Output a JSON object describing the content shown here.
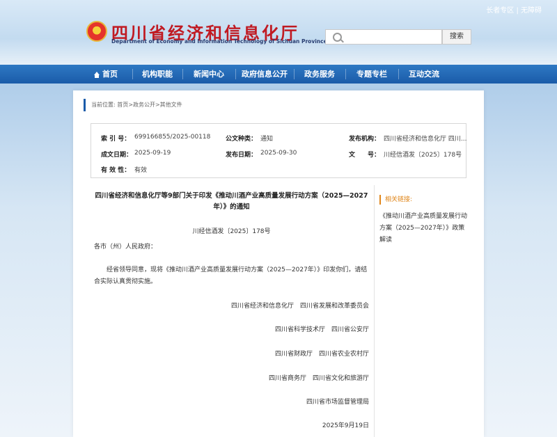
{
  "header": {
    "top_links": {
      "special": "长者专区",
      "separator": "|",
      "accessible": "无障碍"
    },
    "site_title": "四川省经济和信息化厅",
    "site_subtitle": "Department of Economy and Information Technology of Sichuan Province",
    "search": {
      "placeholder": "",
      "button_label": "搜索"
    }
  },
  "nav": {
    "items": [
      {
        "label": "首页"
      },
      {
        "label": "机构职能"
      },
      {
        "label": "新闻中心"
      },
      {
        "label": "政府信息公开"
      },
      {
        "label": "政务服务"
      },
      {
        "label": "专题专栏"
      },
      {
        "label": "互动交流"
      }
    ]
  },
  "breadcrumb": "当前位置: 首页>政务公开>其他文件",
  "meta": {
    "index_no_label": "索 引 号：",
    "index_no": "699166855/2025-00118",
    "category_label": "公文种类：",
    "category": "通知",
    "issuer_label": "发布机构：",
    "issuer": "四川省经济和信息化厅 四川...",
    "created_label": "成文日期：",
    "created": "2025-09-19",
    "published_label": "发布日期：",
    "published": "2025-09-30",
    "docno_label": "文　　号：",
    "docno": "川经信酒发〔2025〕178号",
    "validity_label": "有 效 性：",
    "validity": "有效"
  },
  "article": {
    "title": "四川省经济和信息化厅等9部门关于印发《推动川酒产业高质量发展行动方案（2025—2027年）》的通知",
    "doc_number": "川经信酒发〔2025〕178号",
    "addressee": "各市（州）人民政府：",
    "body": "经省领导同意，现将《推动川酒产业高质量发展行动方案（2025—2027年）》印发你们，请结合实际认真贯彻实施。",
    "signatories": [
      "四川省经济和信息化厅　四川省发展和改革委员会",
      "四川省科学技术厅　四川省公安厅",
      "四川省财政厅　四川省农业农村厅",
      "四川省商务厅　四川省文化和旅游厅",
      "四川省市场监督管理局"
    ],
    "date": "2025年9月19日"
  },
  "sidebar": {
    "heading": "相关链接:",
    "links": [
      "《推动川酒产业高质量发展行动方案（2025—2027年）》政策解读"
    ]
  }
}
